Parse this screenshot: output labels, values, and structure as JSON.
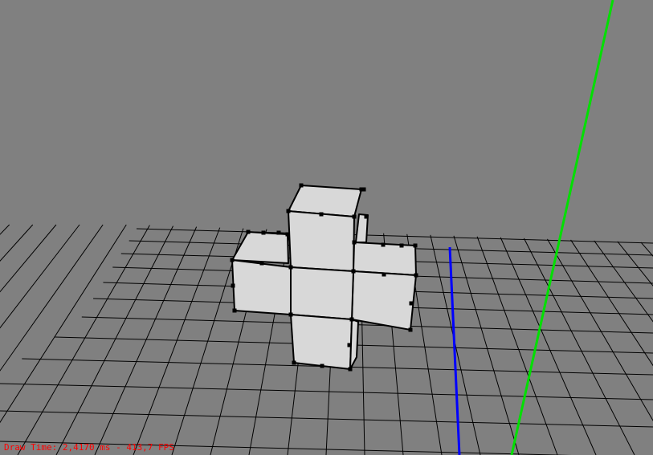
{
  "overlay": {
    "draw_time_text": "Draw Time: 2,4170 ms - 413,7 FPS",
    "text_color": "#ff0000"
  },
  "scene": {
    "background_color": "#808080",
    "grid_color": "#000000",
    "face_fill_color": "#d8d8d8",
    "edge_color": "#000000",
    "vertex_handle_color": "#000000",
    "axis_colors": {
      "y_axis": "#00e000",
      "z_axis": "#0000ff"
    },
    "object": "cross-shaped mesh made of cube faces"
  }
}
